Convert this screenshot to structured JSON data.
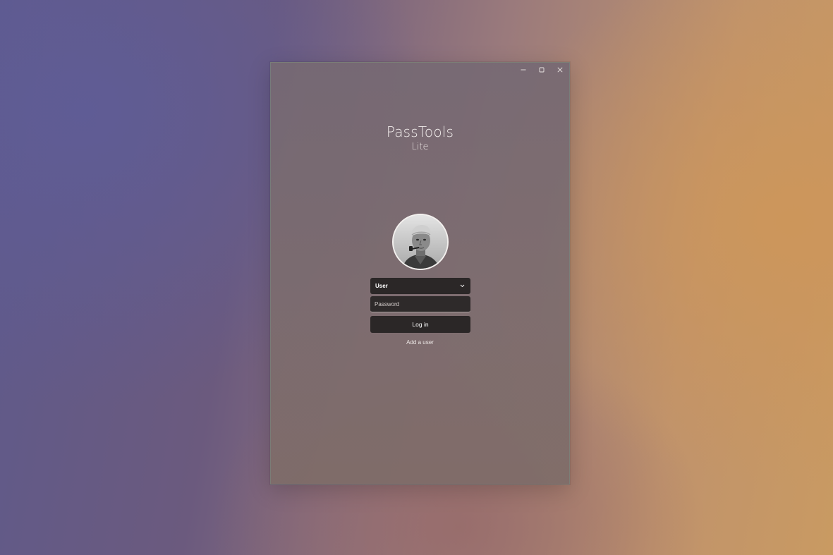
{
  "app": {
    "title": "PassTools",
    "subtitle": "Lite"
  },
  "window_controls": {
    "minimize_icon": "minimize-icon",
    "maximize_icon": "maximize-icon",
    "close_icon": "close-icon"
  },
  "login": {
    "avatar_description": "user-avatar-photo",
    "user_select_value": "User",
    "user_select_icon": "chevron-down-icon",
    "password_placeholder": "Password",
    "login_button_label": "Log in",
    "add_user_link": "Add a user"
  },
  "colors": {
    "control_background": "#2b2727",
    "window_tint": "#786a70",
    "text_light": "#f4efee"
  }
}
